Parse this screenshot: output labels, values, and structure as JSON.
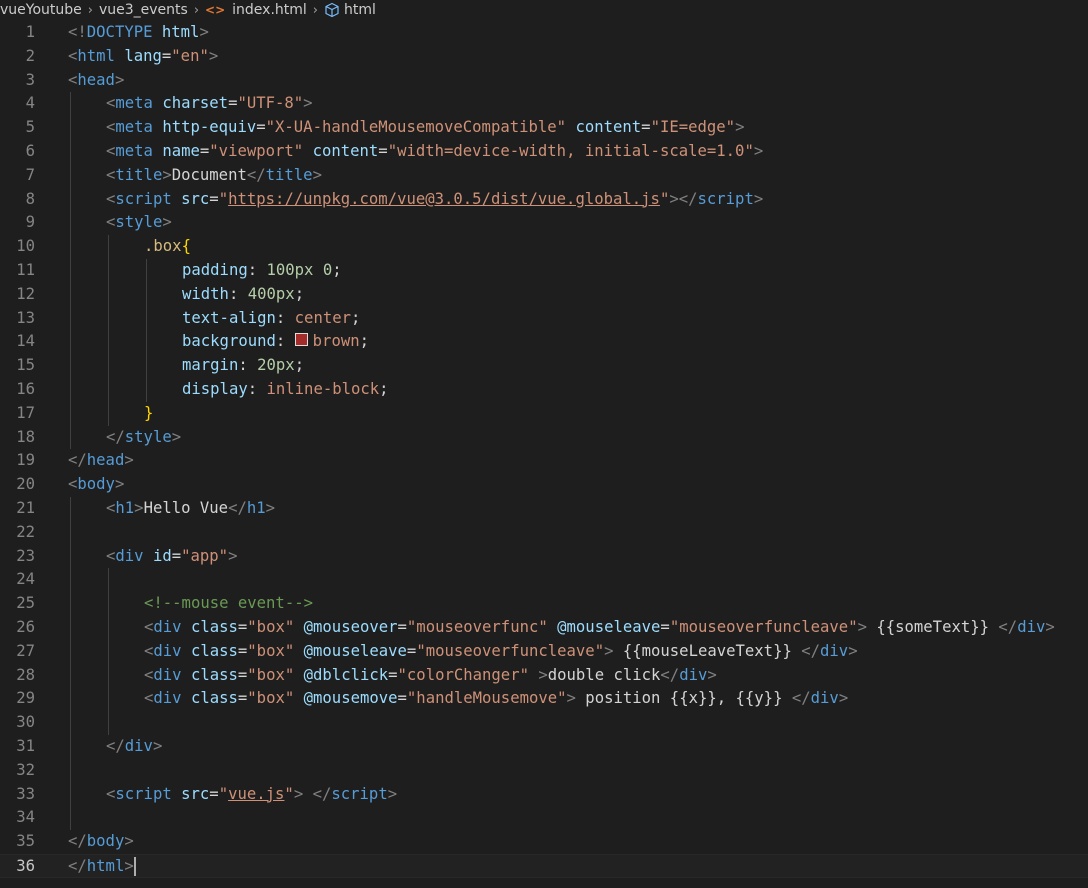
{
  "breadcrumb": {
    "folder1": "vueYoutube",
    "folder2": "vue3_events",
    "file_icon": "<>",
    "file": "index.html",
    "symbol": "html"
  },
  "colors": {
    "brown_swatch": "#a52a2a"
  },
  "editor": {
    "current_line": 36,
    "lines": [
      {
        "n": "1",
        "indent": 0,
        "tokens": [
          [
            "br",
            "<!"
          ],
          [
            "tag",
            "DOCTYPE"
          ],
          [
            "text",
            " "
          ],
          [
            "attr",
            "html"
          ],
          [
            "br",
            ">"
          ]
        ]
      },
      {
        "n": "2",
        "indent": 0,
        "tokens": [
          [
            "br",
            "<"
          ],
          [
            "tag",
            "html"
          ],
          [
            "text",
            " "
          ],
          [
            "attr",
            "lang"
          ],
          [
            "text",
            "="
          ],
          [
            "str",
            "\"en\""
          ],
          [
            "br",
            ">"
          ]
        ]
      },
      {
        "n": "3",
        "indent": 0,
        "tokens": [
          [
            "br",
            "<"
          ],
          [
            "tag",
            "head"
          ],
          [
            "br",
            ">"
          ]
        ]
      },
      {
        "n": "4",
        "indent": 1,
        "tokens": [
          [
            "br",
            "<"
          ],
          [
            "tag",
            "meta"
          ],
          [
            "text",
            " "
          ],
          [
            "attr",
            "charset"
          ],
          [
            "text",
            "="
          ],
          [
            "str",
            "\"UTF-8\""
          ],
          [
            "br",
            ">"
          ]
        ]
      },
      {
        "n": "5",
        "indent": 1,
        "tokens": [
          [
            "br",
            "<"
          ],
          [
            "tag",
            "meta"
          ],
          [
            "text",
            " "
          ],
          [
            "attr",
            "http-equiv"
          ],
          [
            "text",
            "="
          ],
          [
            "str",
            "\"X-UA-handleMousemoveCompatible\""
          ],
          [
            "text",
            " "
          ],
          [
            "attr",
            "content"
          ],
          [
            "text",
            "="
          ],
          [
            "str",
            "\"IE=edge\""
          ],
          [
            "br",
            ">"
          ]
        ]
      },
      {
        "n": "6",
        "indent": 1,
        "tokens": [
          [
            "br",
            "<"
          ],
          [
            "tag",
            "meta"
          ],
          [
            "text",
            " "
          ],
          [
            "attr",
            "name"
          ],
          [
            "text",
            "="
          ],
          [
            "str",
            "\"viewport\""
          ],
          [
            "text",
            " "
          ],
          [
            "attr",
            "content"
          ],
          [
            "text",
            "="
          ],
          [
            "str",
            "\"width=device-width, initial-scale=1.0\""
          ],
          [
            "br",
            ">"
          ]
        ]
      },
      {
        "n": "7",
        "indent": 1,
        "tokens": [
          [
            "br",
            "<"
          ],
          [
            "tag",
            "title"
          ],
          [
            "br",
            ">"
          ],
          [
            "text",
            "Document"
          ],
          [
            "br",
            "</"
          ],
          [
            "tag",
            "title"
          ],
          [
            "br",
            ">"
          ]
        ]
      },
      {
        "n": "8",
        "indent": 1,
        "tokens": [
          [
            "br",
            "<"
          ],
          [
            "tag",
            "script"
          ],
          [
            "text",
            " "
          ],
          [
            "attr",
            "src"
          ],
          [
            "text",
            "="
          ],
          [
            "str",
            "\""
          ],
          [
            "link",
            "https://unpkg.com/vue@3.0.5/dist/vue.global.js"
          ],
          [
            "str",
            "\""
          ],
          [
            "br",
            "></"
          ],
          [
            "tag",
            "script"
          ],
          [
            "br",
            ">"
          ]
        ]
      },
      {
        "n": "9",
        "indent": 1,
        "tokens": [
          [
            "br",
            "<"
          ],
          [
            "tag",
            "style"
          ],
          [
            "br",
            ">"
          ]
        ]
      },
      {
        "n": "10",
        "indent": 2,
        "tokens": [
          [
            "sel",
            ".box"
          ],
          [
            "brace",
            "{"
          ]
        ]
      },
      {
        "n": "11",
        "indent": 3,
        "tokens": [
          [
            "prop",
            "padding"
          ],
          [
            "text",
            ": "
          ],
          [
            "num",
            "100px"
          ],
          [
            "text",
            " "
          ],
          [
            "num",
            "0"
          ],
          [
            "text",
            ";"
          ]
        ]
      },
      {
        "n": "12",
        "indent": 3,
        "tokens": [
          [
            "prop",
            "width"
          ],
          [
            "text",
            ": "
          ],
          [
            "num",
            "400px"
          ],
          [
            "text",
            ";"
          ]
        ]
      },
      {
        "n": "13",
        "indent": 3,
        "tokens": [
          [
            "prop",
            "text-align"
          ],
          [
            "text",
            ": "
          ],
          [
            "val",
            "center"
          ],
          [
            "text",
            ";"
          ]
        ]
      },
      {
        "n": "14",
        "indent": 3,
        "tokens": [
          [
            "prop",
            "background"
          ],
          [
            "text",
            ": "
          ],
          [
            "swatch",
            ""
          ],
          [
            "val",
            "brown"
          ],
          [
            "text",
            ";"
          ]
        ]
      },
      {
        "n": "15",
        "indent": 3,
        "tokens": [
          [
            "prop",
            "margin"
          ],
          [
            "text",
            ": "
          ],
          [
            "num",
            "20px"
          ],
          [
            "text",
            ";"
          ]
        ]
      },
      {
        "n": "16",
        "indent": 3,
        "tokens": [
          [
            "prop",
            "display"
          ],
          [
            "text",
            ": "
          ],
          [
            "val",
            "inline-block"
          ],
          [
            "text",
            ";"
          ]
        ]
      },
      {
        "n": "17",
        "indent": 2,
        "tokens": [
          [
            "brace",
            "}"
          ]
        ]
      },
      {
        "n": "18",
        "indent": 1,
        "tokens": [
          [
            "br",
            "</"
          ],
          [
            "tag",
            "style"
          ],
          [
            "br",
            ">"
          ]
        ]
      },
      {
        "n": "19",
        "indent": 0,
        "tokens": [
          [
            "br",
            "</"
          ],
          [
            "tag",
            "head"
          ],
          [
            "br",
            ">"
          ]
        ]
      },
      {
        "n": "20",
        "indent": 0,
        "tokens": [
          [
            "br",
            "<"
          ],
          [
            "tag",
            "body"
          ],
          [
            "br",
            ">"
          ]
        ]
      },
      {
        "n": "21",
        "indent": 1,
        "tokens": [
          [
            "br",
            "<"
          ],
          [
            "tag",
            "h1"
          ],
          [
            "br",
            ">"
          ],
          [
            "text",
            "Hello Vue"
          ],
          [
            "br",
            "</"
          ],
          [
            "tag",
            "h1"
          ],
          [
            "br",
            ">"
          ]
        ]
      },
      {
        "n": "22",
        "indent": 0,
        "tokens": []
      },
      {
        "n": "23",
        "indent": 1,
        "tokens": [
          [
            "br",
            "<"
          ],
          [
            "tag",
            "div"
          ],
          [
            "text",
            " "
          ],
          [
            "attr",
            "id"
          ],
          [
            "text",
            "="
          ],
          [
            "str",
            "\"app\""
          ],
          [
            "br",
            ">"
          ]
        ]
      },
      {
        "n": "24",
        "indent": 0,
        "tokens": []
      },
      {
        "n": "25",
        "indent": 2,
        "tokens": [
          [
            "com",
            "<!--mouse event-->"
          ]
        ]
      },
      {
        "n": "26",
        "indent": 2,
        "tokens": [
          [
            "br",
            "<"
          ],
          [
            "tag",
            "div"
          ],
          [
            "text",
            " "
          ],
          [
            "attr",
            "class"
          ],
          [
            "text",
            "="
          ],
          [
            "str",
            "\"box\""
          ],
          [
            "text",
            " "
          ],
          [
            "attr",
            "@mouseover"
          ],
          [
            "text",
            "="
          ],
          [
            "str",
            "\"mouseoverfunc\""
          ],
          [
            "text",
            " "
          ],
          [
            "attr",
            "@mouseleave"
          ],
          [
            "text",
            "="
          ],
          [
            "str",
            "\"mouseoverfuncleave\""
          ],
          [
            "br",
            ">"
          ],
          [
            "text",
            " {{someText}} "
          ],
          [
            "br",
            "</"
          ],
          [
            "tag",
            "div"
          ],
          [
            "br",
            ">"
          ]
        ]
      },
      {
        "n": "27",
        "indent": 2,
        "tokens": [
          [
            "br",
            "<"
          ],
          [
            "tag",
            "div"
          ],
          [
            "text",
            " "
          ],
          [
            "attr",
            "class"
          ],
          [
            "text",
            "="
          ],
          [
            "str",
            "\"box\""
          ],
          [
            "text",
            " "
          ],
          [
            "attr",
            "@mouseleave"
          ],
          [
            "text",
            "="
          ],
          [
            "str",
            "\"mouseoverfuncleave\""
          ],
          [
            "br",
            ">"
          ],
          [
            "text",
            " {{mouseLeaveText}} "
          ],
          [
            "br",
            "</"
          ],
          [
            "tag",
            "div"
          ],
          [
            "br",
            ">"
          ]
        ]
      },
      {
        "n": "28",
        "indent": 2,
        "tokens": [
          [
            "br",
            "<"
          ],
          [
            "tag",
            "div"
          ],
          [
            "text",
            " "
          ],
          [
            "attr",
            "class"
          ],
          [
            "text",
            "="
          ],
          [
            "str",
            "\"box\""
          ],
          [
            "text",
            " "
          ],
          [
            "attr",
            "@dblclick"
          ],
          [
            "text",
            "="
          ],
          [
            "str",
            "\"colorChanger\""
          ],
          [
            "text",
            " "
          ],
          [
            "br",
            ">"
          ],
          [
            "text",
            "double click"
          ],
          [
            "br",
            "</"
          ],
          [
            "tag",
            "div"
          ],
          [
            "br",
            ">"
          ]
        ]
      },
      {
        "n": "29",
        "indent": 2,
        "tokens": [
          [
            "br",
            "<"
          ],
          [
            "tag",
            "div"
          ],
          [
            "text",
            " "
          ],
          [
            "attr",
            "class"
          ],
          [
            "text",
            "="
          ],
          [
            "str",
            "\"box\""
          ],
          [
            "text",
            " "
          ],
          [
            "attr",
            "@mousemove"
          ],
          [
            "text",
            "="
          ],
          [
            "str",
            "\"handleMousemove\""
          ],
          [
            "br",
            ">"
          ],
          [
            "text",
            " position {{x}}, {{y}} "
          ],
          [
            "br",
            "</"
          ],
          [
            "tag",
            "div"
          ],
          [
            "br",
            ">"
          ]
        ]
      },
      {
        "n": "30",
        "indent": 0,
        "tokens": []
      },
      {
        "n": "31",
        "indent": 1,
        "tokens": [
          [
            "br",
            "</"
          ],
          [
            "tag",
            "div"
          ],
          [
            "br",
            ">"
          ]
        ]
      },
      {
        "n": "32",
        "indent": 0,
        "tokens": []
      },
      {
        "n": "33",
        "indent": 1,
        "tokens": [
          [
            "br",
            "<"
          ],
          [
            "tag",
            "script"
          ],
          [
            "text",
            " "
          ],
          [
            "attr",
            "src"
          ],
          [
            "text",
            "="
          ],
          [
            "str",
            "\""
          ],
          [
            "link",
            "vue.js"
          ],
          [
            "str",
            "\""
          ],
          [
            "br",
            ">"
          ],
          [
            "text",
            " "
          ],
          [
            "br",
            "</"
          ],
          [
            "tag",
            "script"
          ],
          [
            "br",
            ">"
          ]
        ]
      },
      {
        "n": "34",
        "indent": 0,
        "tokens": []
      },
      {
        "n": "35",
        "indent": 0,
        "tokens": [
          [
            "br",
            "</"
          ],
          [
            "tag",
            "body"
          ],
          [
            "br",
            ">"
          ]
        ]
      },
      {
        "n": "36",
        "indent": 0,
        "tokens": [
          [
            "br",
            "</"
          ],
          [
            "tag",
            "html"
          ],
          [
            "br",
            ">"
          ],
          [
            "cursor",
            ""
          ]
        ]
      }
    ]
  }
}
